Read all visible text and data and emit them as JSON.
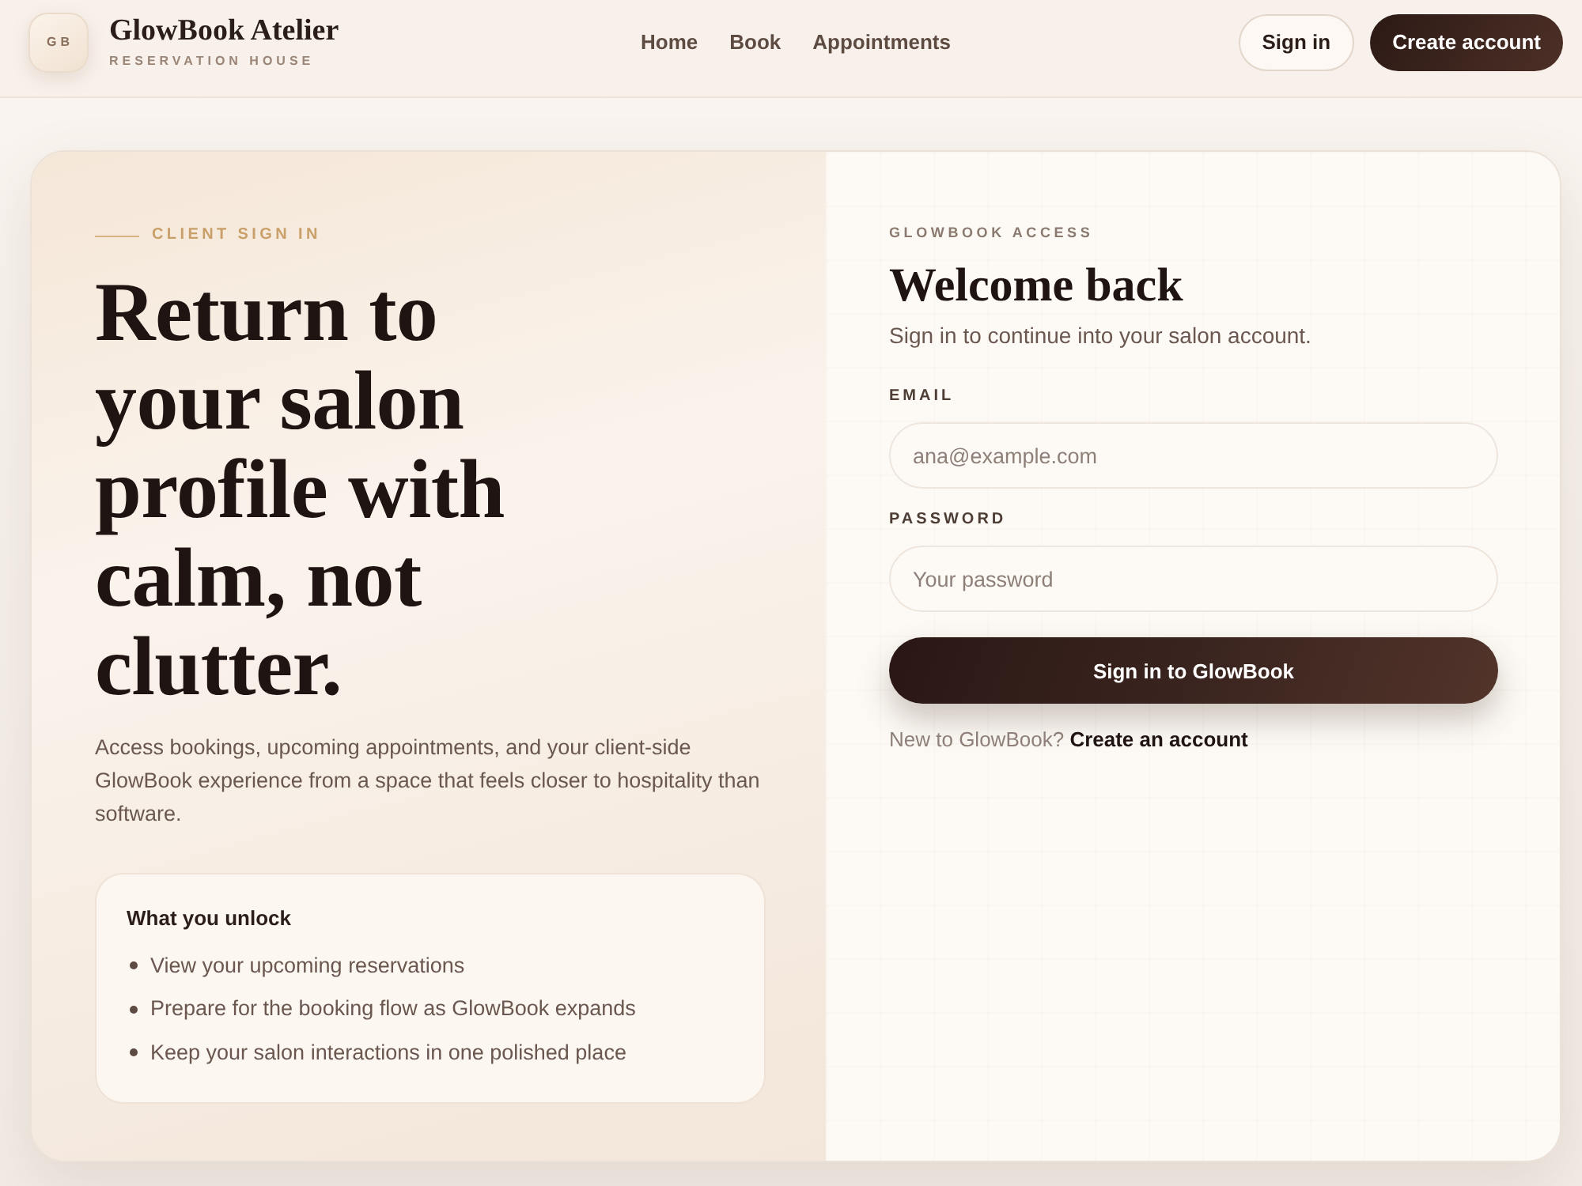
{
  "header": {
    "logo_mark": "GB",
    "brand_name": "GlowBook Atelier",
    "brand_tagline": "RESERVATION HOUSE",
    "nav": [
      {
        "label": "Home"
      },
      {
        "label": "Book"
      },
      {
        "label": "Appointments"
      }
    ],
    "actions": [
      {
        "label": "Sign in",
        "kind": "outline"
      },
      {
        "label": "Create account",
        "kind": "filled"
      }
    ]
  },
  "intro": {
    "eyebrow": "CLIENT SIGN IN",
    "headline": "Return to your salon profile with calm, not clutter.",
    "description": "Access bookings, upcoming appointments, and your client-side GlowBook experience from a space that feels closer to hospitality than software.",
    "unlock_card": {
      "title": "What you unlock",
      "items": [
        "View your upcoming reservations",
        "Prepare for the booking flow as GlowBook expands",
        "Keep your salon interactions in one polished place"
      ]
    }
  },
  "form": {
    "eyebrow": "GLOWBOOK ACCESS",
    "title": "Welcome back",
    "subtitle": "Sign in to continue into your salon account.",
    "fields": [
      {
        "label": "EMAIL",
        "placeholder": "ana@example.com"
      },
      {
        "label": "PASSWORD",
        "placeholder": "Your password"
      }
    ],
    "submit": "Sign in to GlowBook",
    "footer": {
      "prompt": "New to GlowBook?",
      "link": "Create an account"
    }
  }
}
